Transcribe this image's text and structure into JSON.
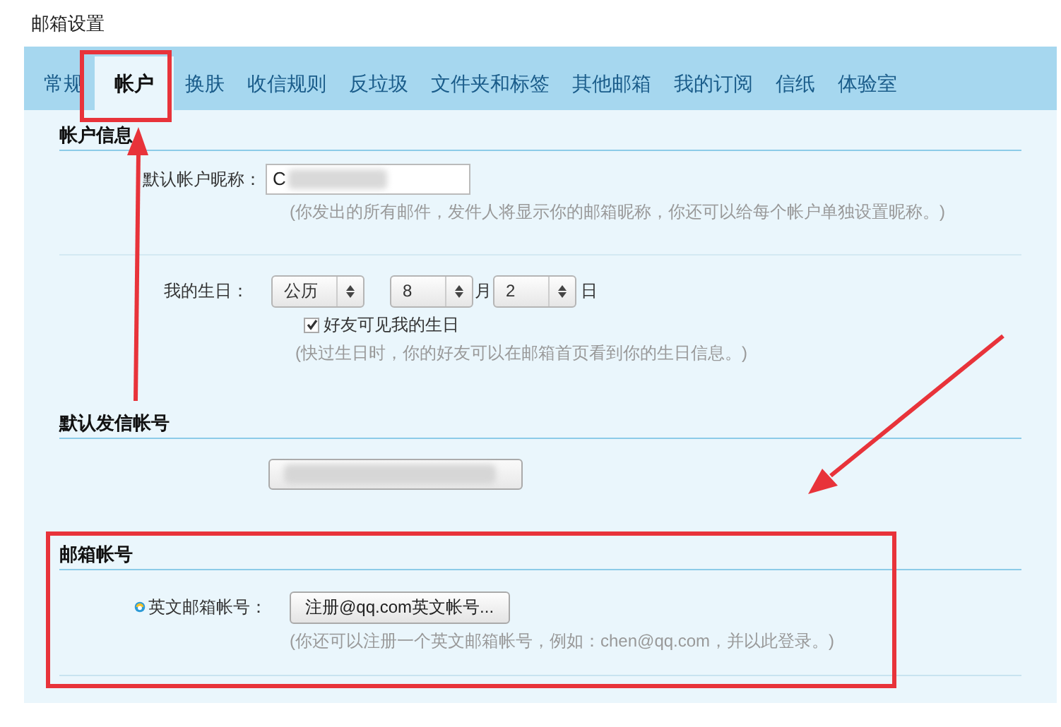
{
  "page_title": "邮箱设置",
  "tabs": [
    {
      "label": "常规",
      "selected": false
    },
    {
      "label": "帐户",
      "selected": true
    },
    {
      "label": "换肤",
      "selected": false
    },
    {
      "label": "收信规则",
      "selected": false
    },
    {
      "label": "反垃圾",
      "selected": false
    },
    {
      "label": "文件夹和标签",
      "selected": false
    },
    {
      "label": "其他邮箱",
      "selected": false
    },
    {
      "label": "我的订阅",
      "selected": false
    },
    {
      "label": "信纸",
      "selected": false
    },
    {
      "label": "体验室",
      "selected": false
    }
  ],
  "account_info": {
    "heading": "帐户信息",
    "nickname_label": "默认帐户昵称：",
    "nickname_value": "C",
    "nickname_hint": "(你发出的所有邮件，发件人将显示你的邮箱昵称，你还可以给每个帐户单独设置昵称。)",
    "birthday_label": "我的生日：",
    "calendar": "公历",
    "month": "8",
    "month_unit": "月",
    "day": "2",
    "day_unit": "日",
    "friends_visible": {
      "label": "好友可见我的生日",
      "checked": true
    },
    "birthday_hint": "(快过生日时，你的好友可以在邮箱首页看到你的生日信息。)"
  },
  "default_sender": {
    "heading": "默认发信帐号"
  },
  "mail_account": {
    "heading": "邮箱帐号",
    "label": "英文邮箱帐号：",
    "button": "注册@qq.com英文帐号...",
    "hint": "(你还可以注册一个英文邮箱帐号，例如：chen@qq.com，并以此登录。)"
  }
}
